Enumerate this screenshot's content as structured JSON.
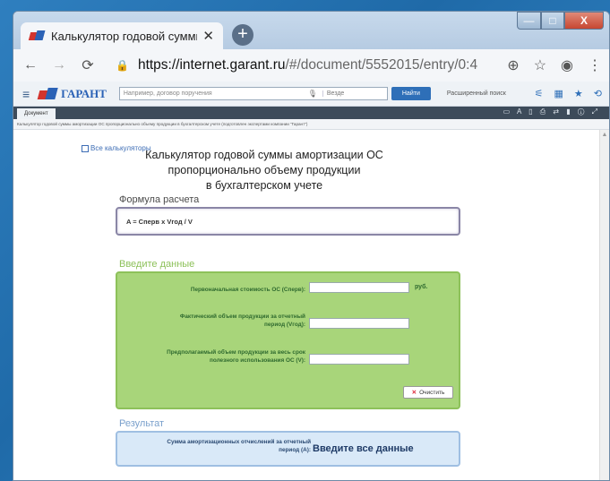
{
  "browser": {
    "tab_title": "Калькулятор годовой суммы ам",
    "tab_close": "✕",
    "new_tab": "+",
    "url_host": "https://internet.garant.ru",
    "url_path": "/#/document/5552015/entry/0:4"
  },
  "window_controls": {
    "minimize": "—",
    "maximize": "□",
    "close": "X"
  },
  "garant": {
    "logo_text": "ГАРАНТ",
    "search_placeholder": "Например, договор поручения",
    "search_scope": "Везде",
    "find_button": "Найти",
    "advanced_search": "Расширенный поиск"
  },
  "doc": {
    "tab_label": "Документ",
    "breadcrumb": "Калькулятор годовой суммы амортизации ОС пропорционально объему продукции в бухгалтерском учете (подготовлен экспертами компании \"Гарант\")"
  },
  "calculator": {
    "all_calculators": "Все калькуляторы",
    "title_line1": "Калькулятор годовой суммы амортизации ОС",
    "title_line2": "пропорционально объему продукции",
    "title_line3": "в бухгалтерском учете",
    "formula_label": "Формула расчета",
    "formula": "A = Cперв x Vгод / V",
    "input_label": "Введите данные",
    "field1_label": "Первоначальная стоимость ОС (Сперв):",
    "field1_unit": "руб.",
    "field2_label_l1": "Фактический объем продукции за отчетный",
    "field2_label_l2": "период (Vгод):",
    "field3_label_l1": "Предполагаемый объем продукции за весь срок",
    "field3_label_l2": "полезного использования ОС (V):",
    "clear_button": "Очистить",
    "result_label": "Результат",
    "result_text_l1": "Сумма амортизационных отчислений за отчетный",
    "result_text_l2": "период (А):",
    "result_value": "Введите все данные"
  },
  "colors": {
    "input_bg": "#a8d57a",
    "result_bg": "#d9e9f8",
    "accent": "#2e6fb8"
  }
}
